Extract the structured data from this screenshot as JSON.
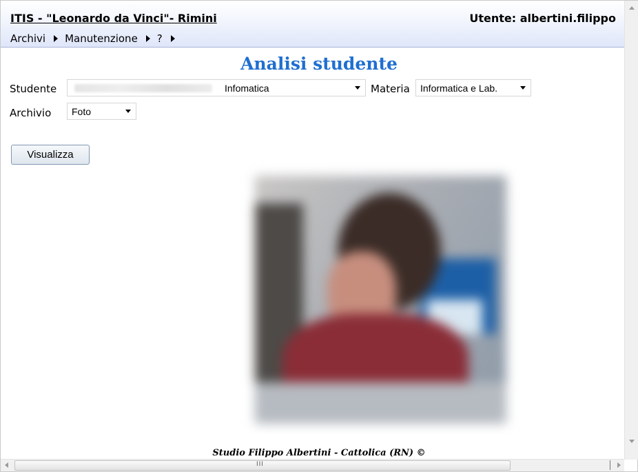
{
  "header": {
    "site_title": "ITIS - \"Leonardo da Vinci\"- Rimini",
    "user": "Utente: albertini.filippo"
  },
  "menu": {
    "items": [
      {
        "label": "Archivi"
      },
      {
        "label": "Manutenzione"
      },
      {
        "label": "?"
      }
    ]
  },
  "page": {
    "title": "Analisi studente"
  },
  "form": {
    "student_label": "Studente",
    "student_value": "Infomatica",
    "subject_label": "Materia",
    "subject_value": "Informatica e Lab.",
    "archive_label": "Archivio",
    "archive_value": "Foto",
    "submit_label": "Visualizza"
  },
  "footer": {
    "text": "Studio Filippo Albertini - Cattolica (RN) ©"
  },
  "scrollbar": {
    "grip": "III"
  },
  "colors": {
    "title": "#1f6fd0",
    "header_gradient_end": "#dfe6fa"
  }
}
